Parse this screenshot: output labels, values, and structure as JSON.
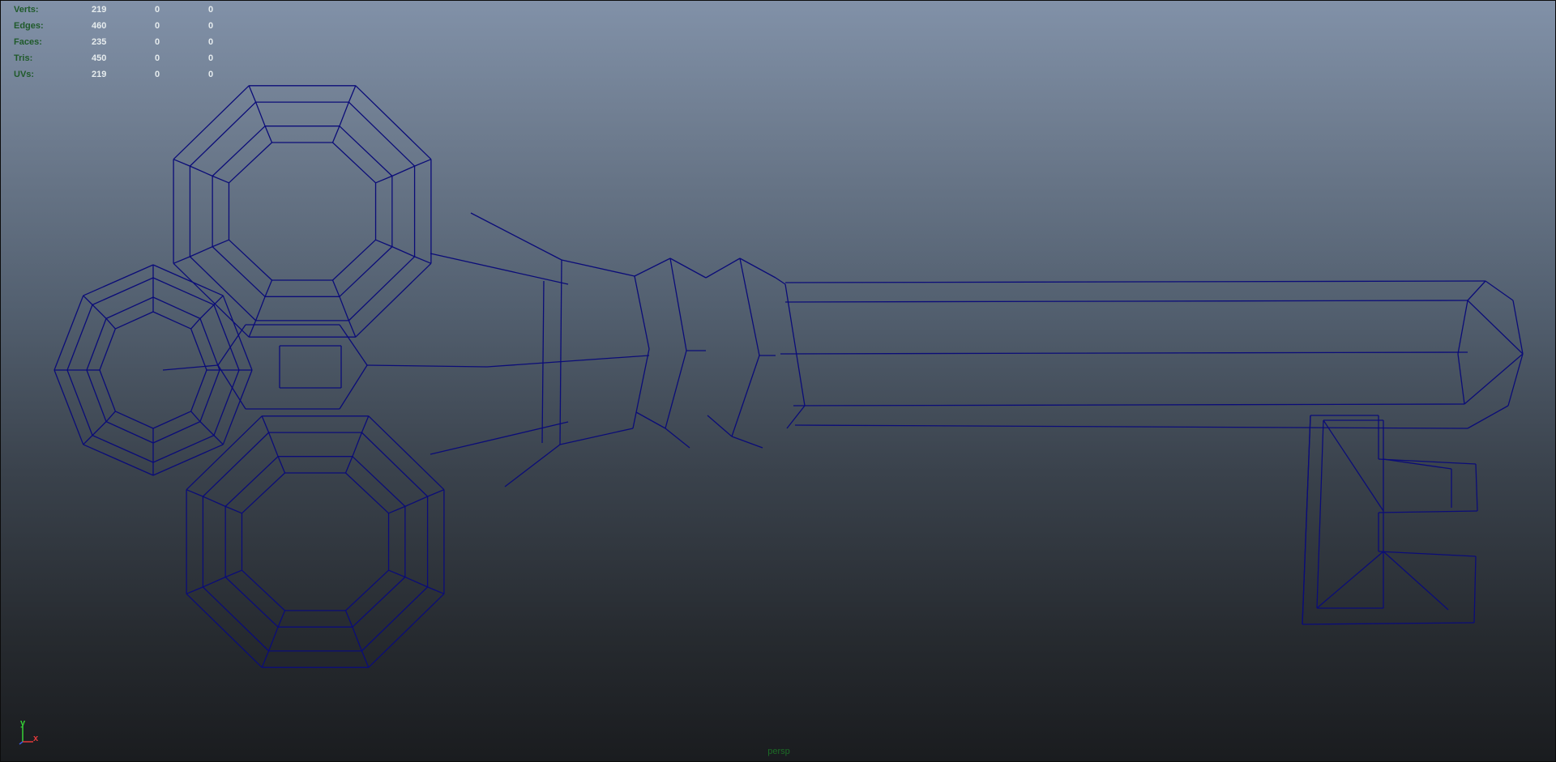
{
  "viewport": {
    "camera_name": "persp",
    "background_top": "#8191a8",
    "background_bottom": "#1a1c1f",
    "wireframe_color": "#0b0c78"
  },
  "hud": {
    "rows": [
      {
        "label": "Verts:",
        "total": "219",
        "selected": "0",
        "component": "0"
      },
      {
        "label": "Edges:",
        "total": "460",
        "selected": "0",
        "component": "0"
      },
      {
        "label": "Faces:",
        "total": "235",
        "selected": "0",
        "component": "0"
      },
      {
        "label": "Tris:",
        "total": "450",
        "selected": "0",
        "component": "0"
      },
      {
        "label": "UVs:",
        "total": "219",
        "selected": "0",
        "component": "0"
      }
    ]
  },
  "axis_gizmo": {
    "y_label": "y",
    "x_label": "x",
    "y_color": "#36d236",
    "x_color": "#e03a3a"
  }
}
